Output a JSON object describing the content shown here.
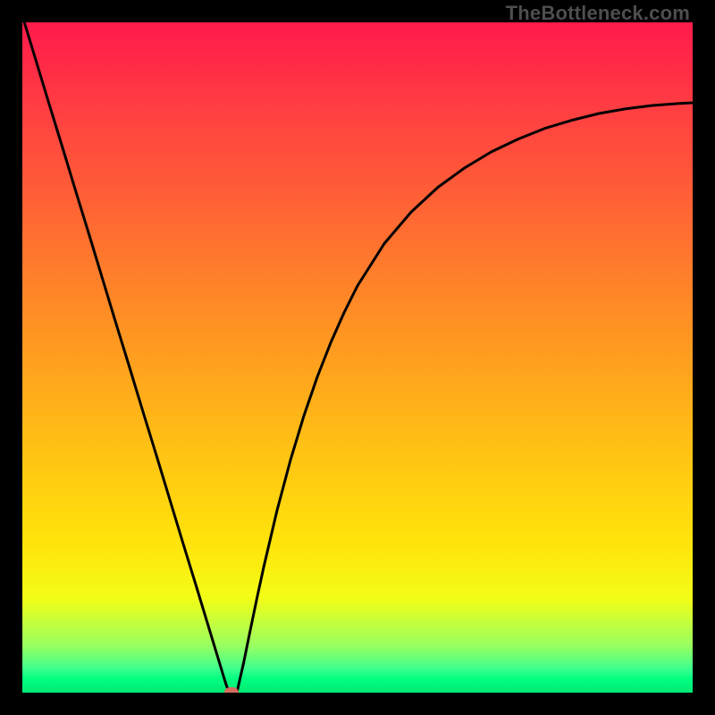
{
  "attribution": "TheBottleneck.com",
  "colors": {
    "curve": "#000000",
    "marker": "#d66b5f",
    "frame": "#000000"
  },
  "chart_data": {
    "type": "line",
    "title": "",
    "xlabel": "",
    "ylabel": "",
    "xlim": [
      0,
      100
    ],
    "ylim": [
      0,
      100
    ],
    "grid": false,
    "series": [
      {
        "name": "bottleneck-curve",
        "x": [
          0,
          2,
          4,
          6,
          8,
          10,
          12,
          14,
          16,
          18,
          20,
          22,
          24,
          26,
          28,
          30,
          30.5,
          31,
          31.5,
          32,
          33,
          34,
          35,
          36,
          38,
          40,
          42,
          44,
          46,
          48,
          50,
          54,
          58,
          62,
          66,
          70,
          74,
          78,
          82,
          86,
          90,
          94,
          98,
          100
        ],
        "y": [
          101,
          94.4,
          87.8,
          81.3,
          74.7,
          68.2,
          61.6,
          55.0,
          48.5,
          41.9,
          35.4,
          28.8,
          22.2,
          15.7,
          9.1,
          2.5,
          0.9,
          0.0,
          0.0,
          0.0,
          4.4,
          9.3,
          14.1,
          18.7,
          27.2,
          34.7,
          41.3,
          47.1,
          52.2,
          56.7,
          60.7,
          67.0,
          71.7,
          75.4,
          78.3,
          80.7,
          82.6,
          84.2,
          85.4,
          86.4,
          87.1,
          87.6,
          87.9,
          88.0
        ]
      }
    ],
    "marker": {
      "x": 31.2,
      "y": 0.0
    }
  }
}
